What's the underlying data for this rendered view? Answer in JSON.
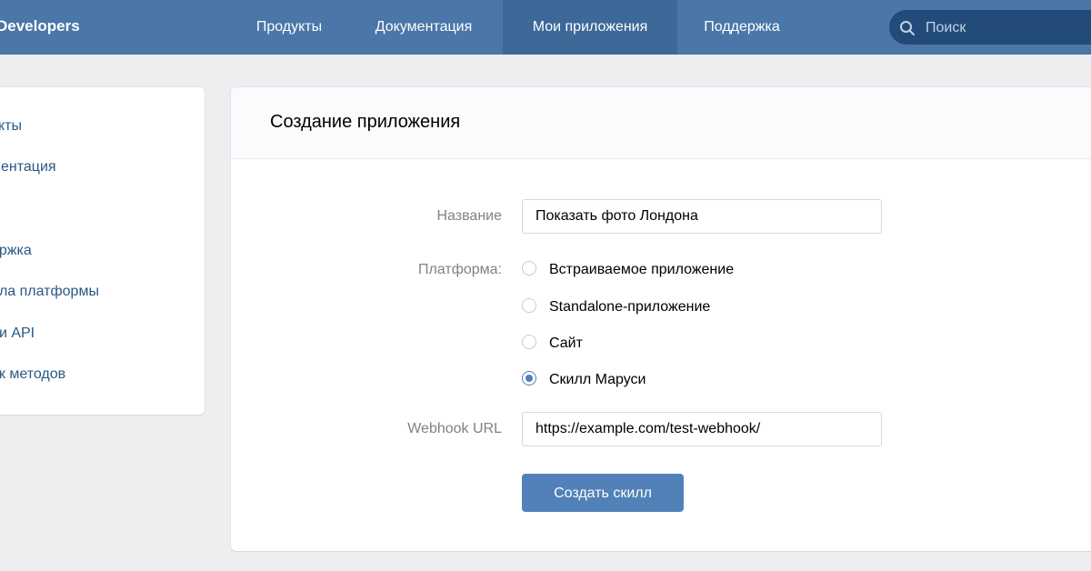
{
  "header": {
    "logo": "Developers",
    "nav": [
      {
        "label": "Продукты",
        "active": false
      },
      {
        "label": "Документация",
        "active": false
      },
      {
        "label": "Мои приложения",
        "active": true
      },
      {
        "label": "Поддержка",
        "active": false
      }
    ],
    "search_placeholder": "Поиск",
    "search_icon": "search-icon"
  },
  "sidebar": {
    "items": [
      {
        "label": "укты"
      },
      {
        "label": "ментация"
      },
      {
        "label": "ержка"
      },
      {
        "label": "ила платформы"
      },
      {
        "label": "ии API"
      },
      {
        "label": "ок методов"
      }
    ]
  },
  "form": {
    "title": "Создание приложения",
    "name_label": "Название",
    "name_value": "Показать фото Лондона",
    "platform_label": "Платформа:",
    "platforms": [
      {
        "label": "Встраиваемое приложение",
        "checked": false
      },
      {
        "label": "Standalone-приложение",
        "checked": false
      },
      {
        "label": "Сайт",
        "checked": false
      },
      {
        "label": "Скилл Маруси",
        "checked": true
      }
    ],
    "webhook_label": "Webhook URL",
    "webhook_value": "https://example.com/test-webhook/",
    "submit_label": "Создать скилл"
  },
  "colors": {
    "header_bg": "#4a76a8",
    "accent": "#5181b8",
    "link": "#2a5885"
  }
}
